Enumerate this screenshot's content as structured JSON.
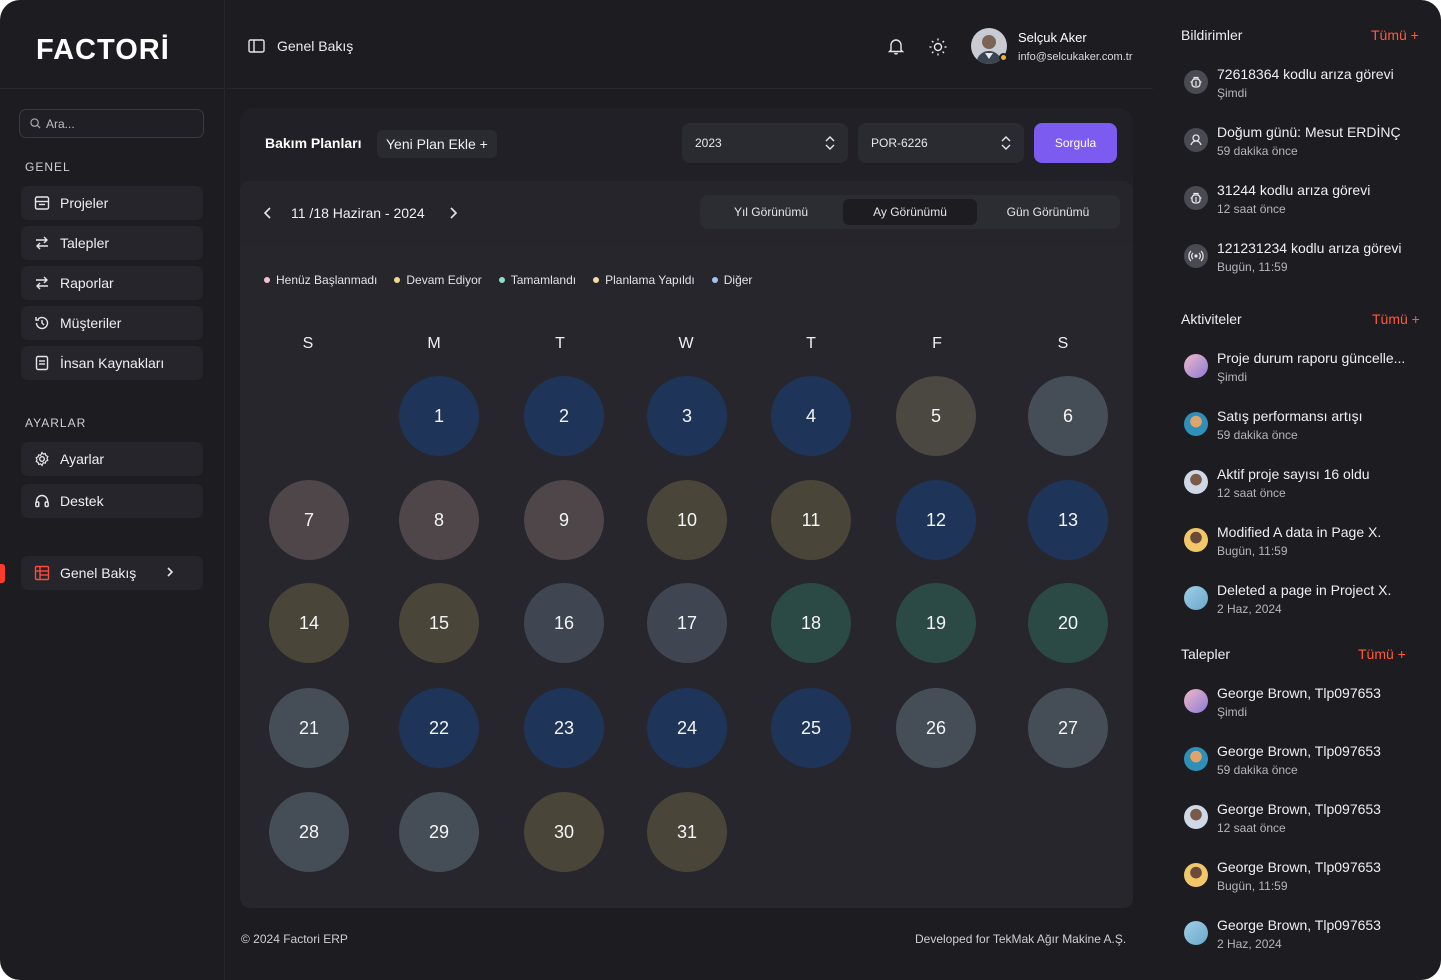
{
  "sidebar": {
    "logo": "FACTORİ",
    "search_placeholder": "Ara...",
    "general_title": "GENEL",
    "general_items": [
      {
        "label": "Projeler",
        "icon": "projects-icon"
      },
      {
        "label": "Talepler",
        "icon": "swap-icon"
      },
      {
        "label": "Raporlar",
        "icon": "swap-icon"
      },
      {
        "label": "Müşteriler",
        "icon": "history-icon"
      },
      {
        "label": "İnsan Kaynakları",
        "icon": "document-icon"
      }
    ],
    "settings_title": "AYARLAR",
    "settings_items": [
      {
        "label": "Ayarlar",
        "icon": "gear-icon"
      },
      {
        "label": "Destek",
        "icon": "headset-icon"
      }
    ],
    "active_item": {
      "label": "Genel Bakış",
      "icon": "grid-icon"
    }
  },
  "header": {
    "breadcrumb": "Genel Bakış",
    "user_name": "Selçuk Aker",
    "user_email": "info@selcukaker.com.tr"
  },
  "plans": {
    "title": "Bakım Planları",
    "new_plan": "Yeni Plan Ekle +",
    "year_value": "2023",
    "code_value": "POR-6226",
    "query_button": "Sorgula"
  },
  "calendar": {
    "range": "11 /18 Haziran - 2024",
    "views": [
      "Yıl Görünümü",
      "Ay Görünümü",
      "Gün Görünümü"
    ],
    "active_view": "Ay Görünümü",
    "legend": [
      {
        "label": "Henüz Başlanmadı",
        "color": "#f2c4d2"
      },
      {
        "label": "Devam Ediyor",
        "color": "#f5d98a"
      },
      {
        "label": "Tamamlandı",
        "color": "#8fe0c4"
      },
      {
        "label": "Planlama Yapıldı",
        "color": "#f6d7a8"
      },
      {
        "label": "Diğer",
        "color": "#9fc3f2"
      }
    ],
    "weekdays": [
      "S",
      "M",
      "T",
      "W",
      "T",
      "F",
      "S"
    ],
    "days": [
      {
        "d": "1",
        "c": "#1e3559"
      },
      {
        "d": "2",
        "c": "#1e3559"
      },
      {
        "d": "3",
        "c": "#1e3559"
      },
      {
        "d": "4",
        "c": "#1e3559"
      },
      {
        "d": "5",
        "c": "#4b4841"
      },
      {
        "d": "6",
        "c": "#454d56"
      },
      {
        "d": "7",
        "c": "#4e4648"
      },
      {
        "d": "8",
        "c": "#4e4648"
      },
      {
        "d": "9",
        "c": "#4e4648"
      },
      {
        "d": "10",
        "c": "#494639"
      },
      {
        "d": "11",
        "c": "#494639"
      },
      {
        "d": "12",
        "c": "#1e3559"
      },
      {
        "d": "13",
        "c": "#1e3559"
      },
      {
        "d": "14",
        "c": "#494639"
      },
      {
        "d": "15",
        "c": "#494639"
      },
      {
        "d": "16",
        "c": "#3f4652"
      },
      {
        "d": "17",
        "c": "#3f4652"
      },
      {
        "d": "18",
        "c": "#2b4a45"
      },
      {
        "d": "19",
        "c": "#2b4a45"
      },
      {
        "d": "20",
        "c": "#2b4a45"
      },
      {
        "d": "21",
        "c": "#454d56"
      },
      {
        "d": "22",
        "c": "#1e3559"
      },
      {
        "d": "23",
        "c": "#1e3559"
      },
      {
        "d": "24",
        "c": "#1e3559"
      },
      {
        "d": "25",
        "c": "#1e3559"
      },
      {
        "d": "26",
        "c": "#454d56"
      },
      {
        "d": "27",
        "c": "#454d56"
      },
      {
        "d": "28",
        "c": "#454d56"
      },
      {
        "d": "29",
        "c": "#454d56"
      },
      {
        "d": "30",
        "c": "#494639"
      },
      {
        "d": "31",
        "c": "#494639"
      }
    ]
  },
  "footer": {
    "left": "© 2024 Factori ERP",
    "right": "Developed for TekMak Ağır Makine A.Ş."
  },
  "notifications": {
    "title": "Bildirimler",
    "all": "Tümü +",
    "items": [
      {
        "title": "72618364 kodlu arıza görevi",
        "time": "Şimdi",
        "icon": "bug-icon"
      },
      {
        "title": "Doğum günü: Mesut ERDİNÇ",
        "time": "59 dakika önce",
        "icon": "user-icon"
      },
      {
        "title": "31244 kodlu arıza görevi",
        "time": "12 saat önce",
        "icon": "bug-icon"
      },
      {
        "title": "121231234 kodlu arıza görevi",
        "time": "Bugün, 11:59",
        "icon": "broadcast-icon"
      }
    ]
  },
  "activities": {
    "title": "Aktiviteler",
    "all": "Tümü +",
    "items": [
      {
        "title": "Proje durum raporu güncelle...",
        "time": "Şimdi"
      },
      {
        "title": "Satış performansı artışı",
        "time": "59 dakika önce"
      },
      {
        "title": "Aktif proje sayısı 16 oldu",
        "time": "12 saat önce"
      },
      {
        "title": "Modified A data in Page X.",
        "time": "Bugün, 11:59"
      },
      {
        "title": "Deleted a page in Project X.",
        "time": "2 Haz, 2024"
      }
    ]
  },
  "requests": {
    "title": "Talepler",
    "all": "Tümü +",
    "items": [
      {
        "title": "George Brown, Tlp097653",
        "time": "Şimdi"
      },
      {
        "title": "George Brown, Tlp097653",
        "time": "59 dakika önce"
      },
      {
        "title": "George Brown, Tlp097653",
        "time": "12 saat önce"
      },
      {
        "title": "George Brown, Tlp097653",
        "time": "Bugün, 11:59"
      },
      {
        "title": "George Brown, Tlp097653",
        "time": "2 Haz, 2024"
      }
    ]
  }
}
